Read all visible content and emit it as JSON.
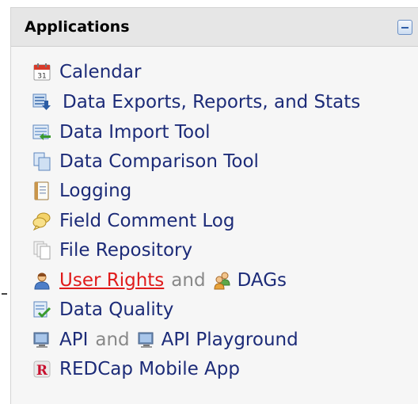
{
  "panel": {
    "title": "Applications",
    "collapse_icon": "minus-collapse-icon"
  },
  "apps": {
    "calendar": {
      "label": "Calendar",
      "icon": "calendar-icon"
    },
    "data_exports": {
      "label": "Data Exports, Reports, and Stats",
      "icon": "data-export-icon"
    },
    "data_import": {
      "label": "Data Import Tool",
      "icon": "data-import-icon"
    },
    "data_comparison": {
      "label": "Data Comparison Tool",
      "icon": "documents-icon"
    },
    "logging": {
      "label": "Logging",
      "icon": "notebook-icon"
    },
    "field_comment_log": {
      "label": "Field Comment Log",
      "icon": "comment-bubbles-icon"
    },
    "file_repository": {
      "label": "File Repository",
      "icon": "file-stack-icon"
    },
    "user_rights": {
      "label": "User Rights",
      "icon": "user-icon",
      "and": "and",
      "dags_label": "DAGs",
      "dags_icon": "user-group-icon"
    },
    "data_quality": {
      "label": "Data Quality",
      "icon": "checklist-icon"
    },
    "api": {
      "label": "API",
      "icon": "computer-icon",
      "and": "and",
      "playground_label": "API Playground",
      "playground_icon": "computer-icon"
    },
    "mobile_app": {
      "label": "REDCap Mobile App",
      "icon": "redcap-logo-icon"
    }
  },
  "colors": {
    "link": "#1c2b78",
    "active_link": "#e01b1b",
    "muted": "#888888",
    "header_bg": "#e6e6e6",
    "panel_bg": "#f6f6f6"
  }
}
